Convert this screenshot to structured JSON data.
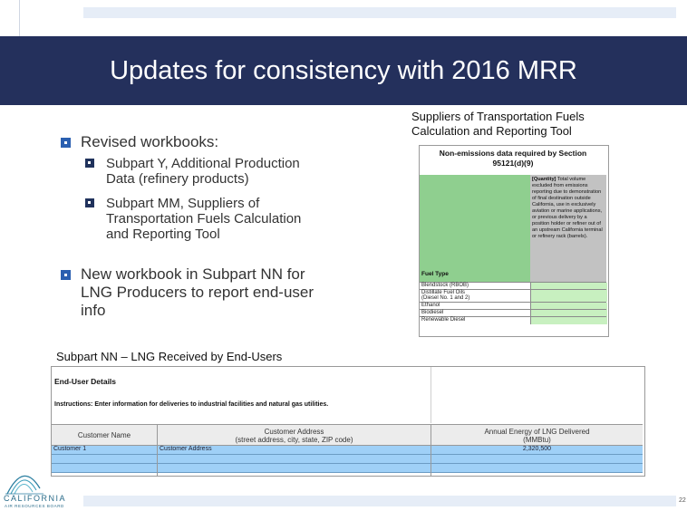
{
  "slide": {
    "title": "Updates for consistency with 2016 MRR",
    "page_number": "22"
  },
  "bullets": {
    "b1": "Revised workbooks:",
    "b1_sub1_l1": "Subpart Y, Additional Production",
    "b1_sub1_l2": "Data (refinery products)",
    "b1_sub2_l1": "Subpart MM, Suppliers of",
    "b1_sub2_l2": "Transportation Fuels Calculation",
    "b1_sub2_l3": "and Reporting Tool",
    "b2_l1": "New workbook in Subpart NN for",
    "b2_l2": "LNG Producers to report end-user",
    "b2_l3": "info"
  },
  "right_caption": {
    "l1": "Suppliers of Transportation Fuels",
    "l2": "Calculation and Reporting Tool"
  },
  "worksheet": {
    "header_l1": "Non-emissions data required by Section",
    "header_l2": "95121(d)(9)",
    "quantity_label": "[Quantity]",
    "quantity_text": "Total volume excluded from emissions reporting due to demonstration of final destination outside California, use in exclusively aviation or marine applications, or previous delivery by a position holder or refiner out of an upstream California terminal or refinery rack (barrels).",
    "fuel_type_label": "Fuel Type",
    "rows": [
      "Blendstock (RBOB)",
      "Distillate Fuel Oils",
      "(Diesel No. 1 and 2)",
      "Ethanol",
      "Biodiesel",
      "Renewable Diesel"
    ]
  },
  "bottom_caption": "Subpart NN – LNG Received by End-Users",
  "table": {
    "title": "End-User Details",
    "instructions": "Instructions: Enter information for deliveries to industrial facilities and natural gas utilities.",
    "col1": "Customer Name",
    "col2_l1": "Customer Address",
    "col2_l2": "(street address, city, state, ZIP code)",
    "col3_l1": "Annual Energy of LNG Delivered",
    "col3_l2": "(MMBtu)",
    "row1": {
      "name": "Customer 1",
      "address": "Customer Address",
      "energy": "2,320,500"
    }
  },
  "logo": {
    "name": "CALIFORNIA",
    "sub": "AIR RESOURCES BOARD"
  },
  "colors": {
    "title_band": "#24305c",
    "bullet_blue": "#2a5fb0",
    "worksheet_green": "#8fcf8f",
    "table_row_blue": "#9fd0f7"
  }
}
